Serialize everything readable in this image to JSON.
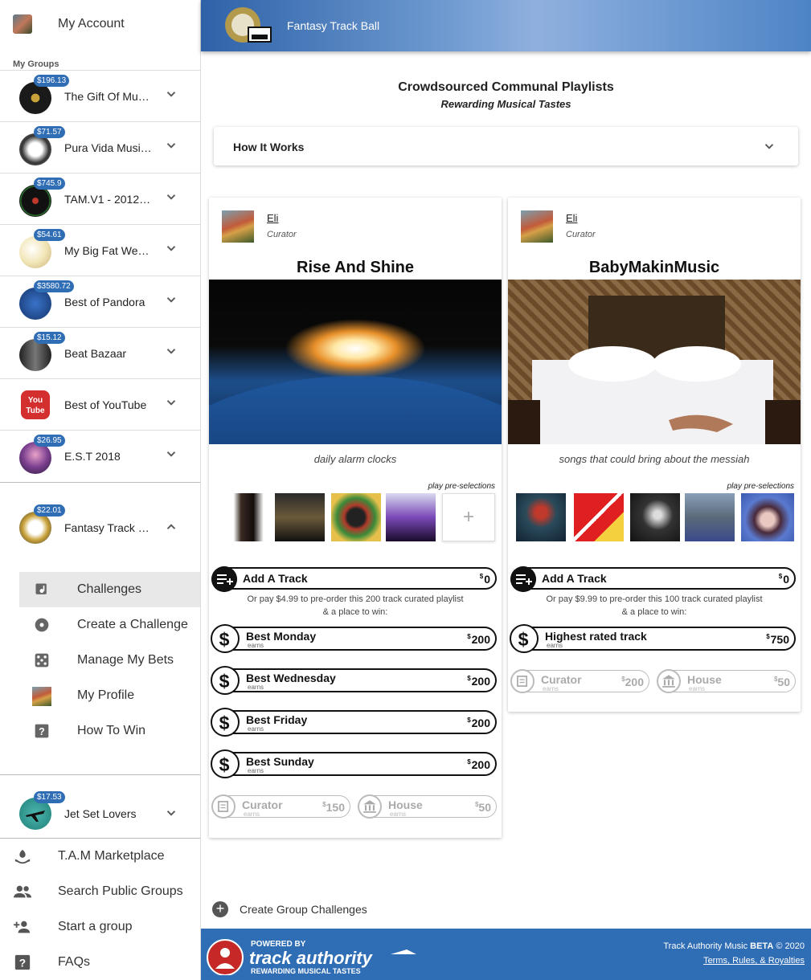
{
  "sidebar": {
    "account_label": "My Account",
    "my_groups_label": "My Groups",
    "groups": [
      {
        "badge": "$196.13",
        "name": "The Gift Of Mu…",
        "expanded": false
      },
      {
        "badge": "$71.57",
        "name": "Pura Vida Musi…",
        "expanded": false
      },
      {
        "badge": "$745.9",
        "name": "TAM.V1 - 2012 …",
        "expanded": false
      },
      {
        "badge": "$54.61",
        "name": "My Big Fat Wed…",
        "expanded": false
      },
      {
        "badge": "$3580.72",
        "name": "Best of Pandora",
        "expanded": false
      },
      {
        "badge": "$15.12",
        "name": "Beat Bazaar",
        "expanded": false
      },
      {
        "badge": "",
        "name": "Best of YouTube",
        "expanded": false
      },
      {
        "badge": "$26.95",
        "name": "E.S.T 2018",
        "expanded": false
      },
      {
        "badge": "$22.01",
        "name": "Fantasy Track …",
        "expanded": true
      },
      {
        "badge": "$17.53",
        "name": "Jet Set Lovers",
        "expanded": false
      }
    ],
    "submenu": [
      {
        "label": "Challenges",
        "icon": "playlist-music-icon",
        "active": true
      },
      {
        "label": "Create a Challenge",
        "icon": "record-icon",
        "active": false
      },
      {
        "label": "Manage My Bets",
        "icon": "dice-icon",
        "active": false
      },
      {
        "label": "My Profile",
        "icon": "profile-avatar-icon",
        "active": false
      },
      {
        "label": "How To Win",
        "icon": "help-icon",
        "active": false
      }
    ],
    "bottom": [
      {
        "label": "T.A.M Marketplace",
        "icon": "hand-coin-icon"
      },
      {
        "label": "Search Public Groups",
        "icon": "people-icon"
      },
      {
        "label": "Start a group",
        "icon": "add-person-icon"
      },
      {
        "label": "FAQs",
        "icon": "help-icon"
      }
    ]
  },
  "header": {
    "title": "Fantasy Track Ball",
    "logo_text": "Fantasy Track Ball"
  },
  "main": {
    "heading": "Crowdsourced Communal Playlists",
    "subheading": "Rewarding Musical Tastes",
    "how_it_works": "How It Works",
    "create_group_challenges": "Create Group Challenges"
  },
  "cards": [
    {
      "curator_name": "Eli",
      "curator_role": "Curator",
      "title": "Rise And Shine",
      "description": "daily alarm clocks",
      "pre_selections_label": "play pre-selections",
      "add_track": {
        "label": "Add A Track",
        "currency": "$",
        "value": "0"
      },
      "or_pay_line1": "Or pay $4.99 to pre-order this 200 track curated playlist",
      "or_pay_line2": "& a place to win:",
      "prizes": [
        {
          "label": "Best Monday",
          "sub": "earns",
          "currency": "$",
          "value": "200"
        },
        {
          "label": "Best Wednesday",
          "sub": "earns",
          "currency": "$",
          "value": "200"
        },
        {
          "label": "Best Friday",
          "sub": "earns",
          "currency": "$",
          "value": "200"
        },
        {
          "label": "Best Sunday",
          "sub": "earns",
          "currency": "$",
          "value": "200"
        }
      ],
      "curator_prize": {
        "label": "Curator",
        "sub": "earns",
        "currency": "$",
        "value": "150"
      },
      "house_prize": {
        "label": "House",
        "sub": "earns",
        "currency": "$",
        "value": "50"
      }
    },
    {
      "curator_name": "Eli",
      "curator_role": "Curator",
      "title": "BabyMakinMusic",
      "description": "songs that could bring about the messiah",
      "pre_selections_label": "play pre-selections",
      "add_track": {
        "label": "Add A Track",
        "currency": "$",
        "value": "0"
      },
      "or_pay_line1": "Or pay $9.99 to pre-order this 100 track curated playlist",
      "or_pay_line2": "& a place to win:",
      "prizes": [
        {
          "label": "Highest rated track",
          "sub": "earns",
          "currency": "$",
          "value": "750"
        }
      ],
      "curator_prize": {
        "label": "Curator",
        "sub": "earns",
        "currency": "$",
        "value": "200"
      },
      "house_prize": {
        "label": "House",
        "sub": "earns",
        "currency": "$",
        "value": "50"
      }
    }
  ],
  "footer": {
    "powered_by": "POWERED BY",
    "brand": "track authority",
    "tagline": "REWARDING MUSICAL TASTES",
    "copyright_prefix": "Track Authority Music",
    "beta": "BETA",
    "copyright_suffix": "© 2020",
    "terms": "Terms, Rules, & Royalties"
  },
  "colors": {
    "brand_blue": "#2f6db5",
    "badge_blue": "#2f6db5",
    "active_bg": "#e8e8e8"
  }
}
